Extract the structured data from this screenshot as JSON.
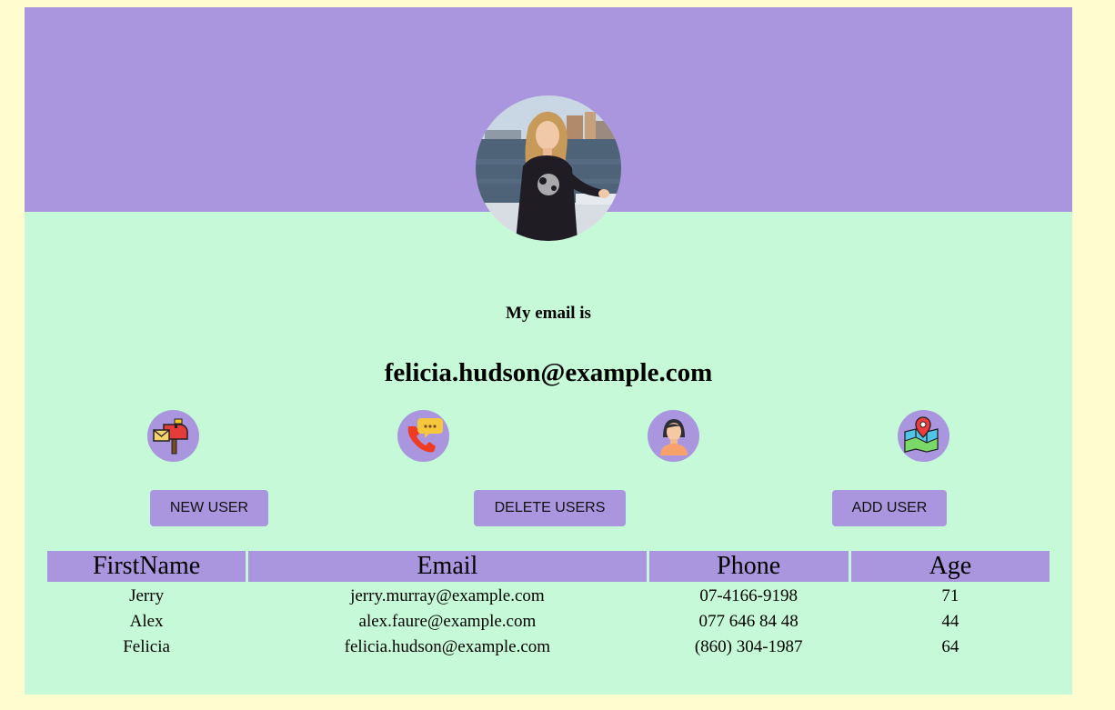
{
  "profile": {
    "label": "My email is",
    "value": "felicia.hudson@example.com",
    "avatar_alt": "profile-photo"
  },
  "icons": [
    {
      "name": "mailbox-icon",
      "meaning": "email"
    },
    {
      "name": "phone-call-icon",
      "meaning": "phone"
    },
    {
      "name": "user-profile-icon",
      "meaning": "name"
    },
    {
      "name": "map-location-icon",
      "meaning": "location"
    }
  ],
  "buttons": {
    "new_user": "NEW USER",
    "delete_users": "DELETE USERS",
    "add_user": "ADD USER"
  },
  "table": {
    "headers": [
      "FirstName",
      "Email",
      "Phone",
      "Age"
    ],
    "rows": [
      [
        "Jerry",
        "jerry.murray@example.com",
        "07-4166-9198",
        "71"
      ],
      [
        "Alex",
        "alex.faure@example.com",
        "077 646 84 48",
        "44"
      ],
      [
        "Felicia",
        "felicia.hudson@example.com",
        "(860) 304-1987",
        "64"
      ]
    ]
  },
  "colors": {
    "page_background": "#fffdd0",
    "card_background": "#c6f9d7",
    "accent": "#a996de"
  }
}
